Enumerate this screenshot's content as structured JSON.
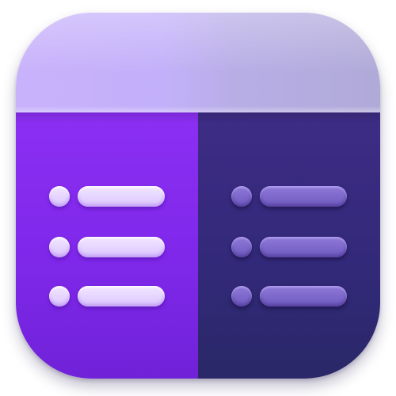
{
  "icon": {
    "name": "two-column-list-app-icon",
    "colors": {
      "header": "#c8b2fb",
      "left_panel": "#8b2ff3",
      "right_panel": "#33297a",
      "left_items": "#e8d9ff",
      "right_items": "#7e69cc"
    },
    "columns": [
      {
        "id": "left",
        "rows": 3
      },
      {
        "id": "right",
        "rows": 3
      }
    ]
  }
}
